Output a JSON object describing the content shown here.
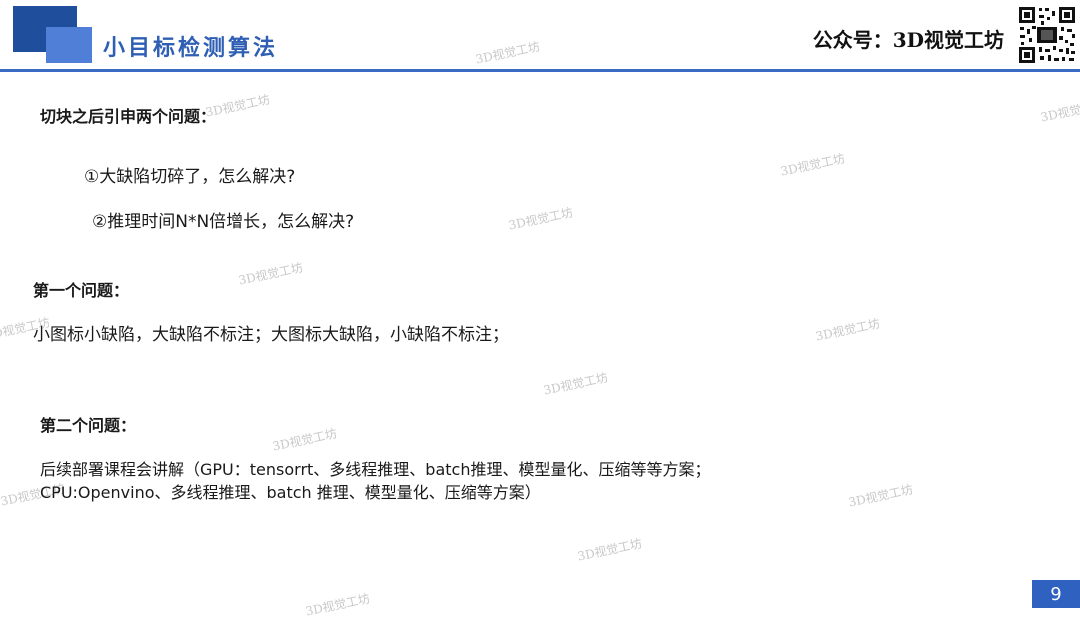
{
  "header": {
    "title": "小目标检测算法",
    "channel": "公众号：3D视觉工坊",
    "accent_color": "#2f62c0"
  },
  "watermark": "3D视觉工坊",
  "sections": {
    "intro_heading": "切块之后引申两个问题：",
    "issue_1": "①大缺陷切碎了，怎么解决?",
    "issue_2": "②推理时间N*N倍增长，怎么解决?",
    "q1_heading": "第一个问题：",
    "q1_body": "小图标小缺陷，大缺陷不标注；大图标大缺陷，小缺陷不标注；",
    "q2_heading": "第二个问题：",
    "q2_line1": "后续部署课程会讲解（GPU：tensorrt、多线程推理、batch推理、模型量化、压缩等等方案；",
    "q2_line2": "CPU:Openvino、多线程推理、batch 推理、模型量化、压缩等方案）"
  },
  "page_number": "9"
}
